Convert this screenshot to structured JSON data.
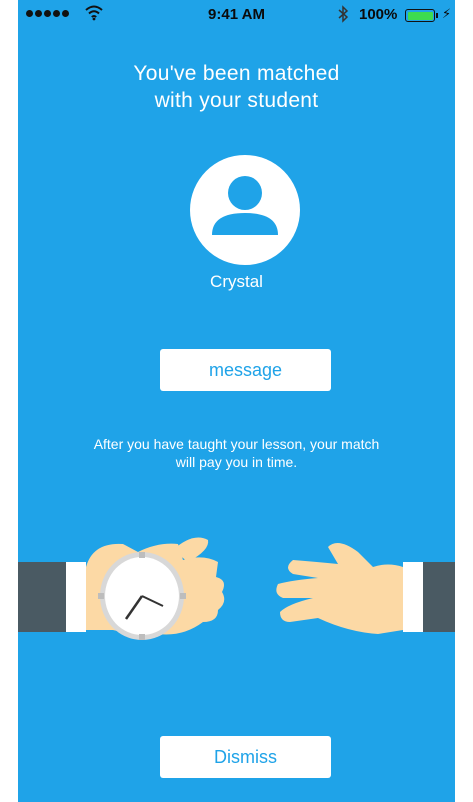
{
  "status_bar": {
    "time": "9:41 AM",
    "battery_percent": "100%",
    "signal_bars": 5,
    "icons": [
      "signal-icon",
      "wifi-icon",
      "bluetooth-icon",
      "battery-icon",
      "charging-bolt-icon"
    ]
  },
  "match": {
    "headline_line1": "You've been matched",
    "headline_line2": "with your student",
    "student_name": "Crystal",
    "avatar_icon": "person-icon",
    "message_label": "message",
    "info_text": "After you have taught your lesson, your match will pay you in time.",
    "dismiss_label": "Dismiss"
  },
  "colors": {
    "background": "#1fa3e8",
    "button_bg": "#ffffff",
    "button_text": "#1fa3e8",
    "skin": "#fcd9a5",
    "sleeve": "#4a5a63",
    "cuff": "#ffffff",
    "battery": "#3ddc4f"
  }
}
